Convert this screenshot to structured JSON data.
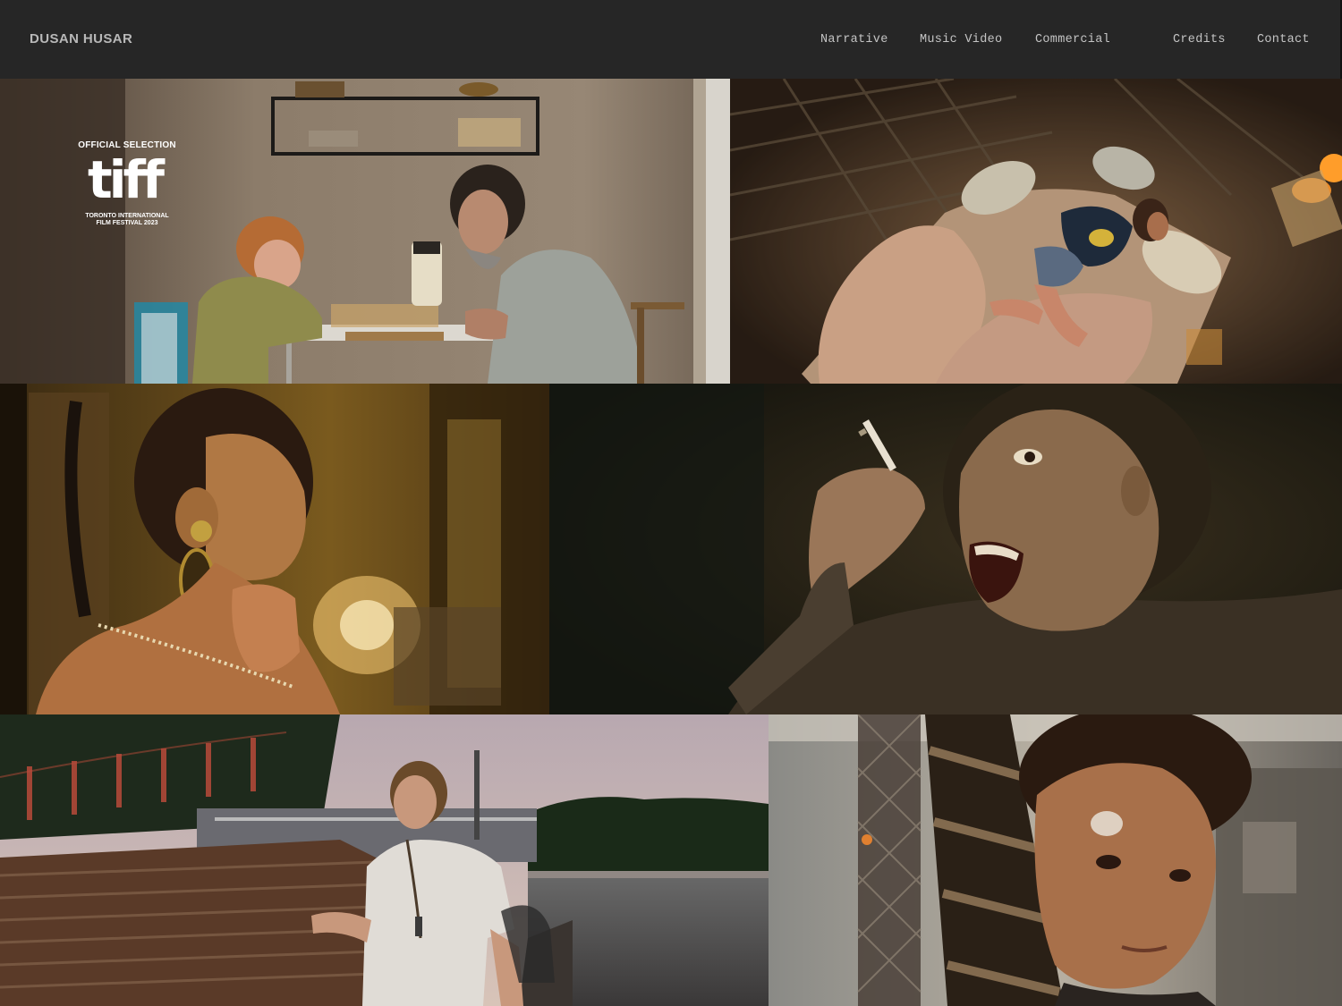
{
  "header": {
    "brand": "DUSAN HUSAR",
    "nav": {
      "narrative": "Narrative",
      "music_video": "Music Video",
      "commercial": "Commercial",
      "credits": "Credits",
      "contact": "Contact"
    }
  },
  "gallery": {
    "badge": {
      "top": "OFFICIAL SELECTION",
      "logo": "tiff",
      "bottom": "TORONTO INTERNATIONAL\nFILM FESTIVAL 2023"
    }
  },
  "colors": {
    "header_bg": "#262626",
    "brand": "#b8b8b8",
    "nav_text": "#c4c4c4"
  }
}
